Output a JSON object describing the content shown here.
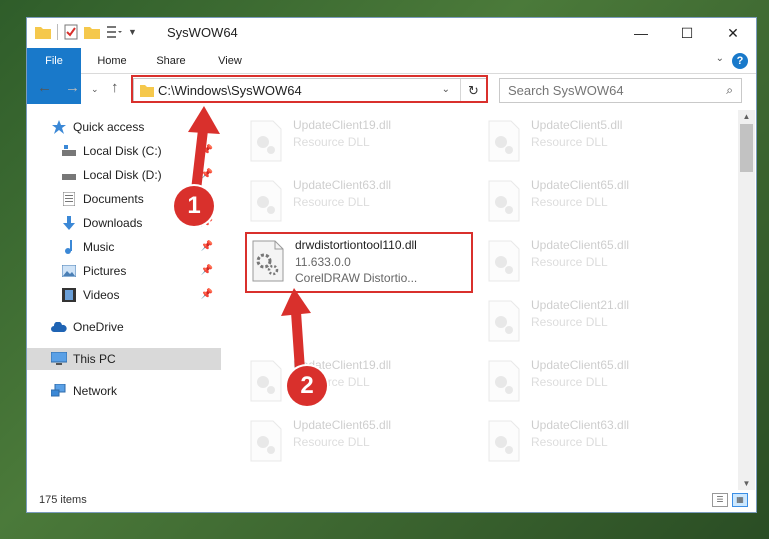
{
  "window": {
    "title": "SysWOW64",
    "minimize": "—",
    "maximize": "☐",
    "close": "✕"
  },
  "ribbon": {
    "tabs": [
      "File",
      "Home",
      "Share",
      "View"
    ],
    "help": "?"
  },
  "nav": {
    "address_path": "C:\\Windows\\SysWOW64",
    "search_placeholder": "Search SysWOW64"
  },
  "sidebar": {
    "items": [
      {
        "label": "Quick access",
        "icon": "star-icon"
      },
      {
        "label": "Local Disk (C:)",
        "icon": "drive-icon",
        "pinned": true
      },
      {
        "label": "Local Disk (D:)",
        "icon": "drive-icon",
        "pinned": true
      },
      {
        "label": "Documents",
        "icon": "document-icon",
        "pinned": true
      },
      {
        "label": "Downloads",
        "icon": "download-icon",
        "pinned": true
      },
      {
        "label": "Music",
        "icon": "music-icon",
        "pinned": true
      },
      {
        "label": "Pictures",
        "icon": "picture-icon",
        "pinned": true
      },
      {
        "label": "Videos",
        "icon": "video-icon",
        "pinned": true
      },
      {
        "label": "OneDrive",
        "icon": "cloud-icon"
      },
      {
        "label": "This PC",
        "icon": "computer-icon"
      },
      {
        "label": "Network",
        "icon": "network-icon"
      }
    ]
  },
  "files": [
    {
      "name": "UpdateClient19.dll",
      "desc": "Resource DLL"
    },
    {
      "name": "UpdateClient5.dll",
      "desc": "Resource DLL"
    },
    {
      "name": "UpdateClient63.dll",
      "desc": "Resource DLL"
    },
    {
      "name": "UpdateClient65.dll",
      "desc": "Resource DLL"
    },
    {
      "name": "drwdistortiontool110.dll",
      "version": "11.633.0.0",
      "desc": "CorelDRAW Distortio..."
    },
    {
      "name": "UpdateClient65.dll",
      "desc": "Resource DLL"
    },
    {
      "name": "UpdateClient21.dll",
      "desc": "Resource DLL"
    },
    {
      "name": "UpdateClient19.dll",
      "desc": "Resource DLL"
    },
    {
      "name": "UpdateClient65.dll",
      "desc": "Resource DLL"
    },
    {
      "name": "UpdateClient65.dll",
      "desc": "Resource DLL"
    },
    {
      "name": "UpdateClient63.dll",
      "desc": "Resource DLL"
    }
  ],
  "status": {
    "item_count": "175 items"
  },
  "annotations": {
    "marker1": "1",
    "marker2": "2",
    "color": "#d9302c"
  },
  "colors": {
    "accent": "#1979ca",
    "highlight": "#d9302c"
  }
}
